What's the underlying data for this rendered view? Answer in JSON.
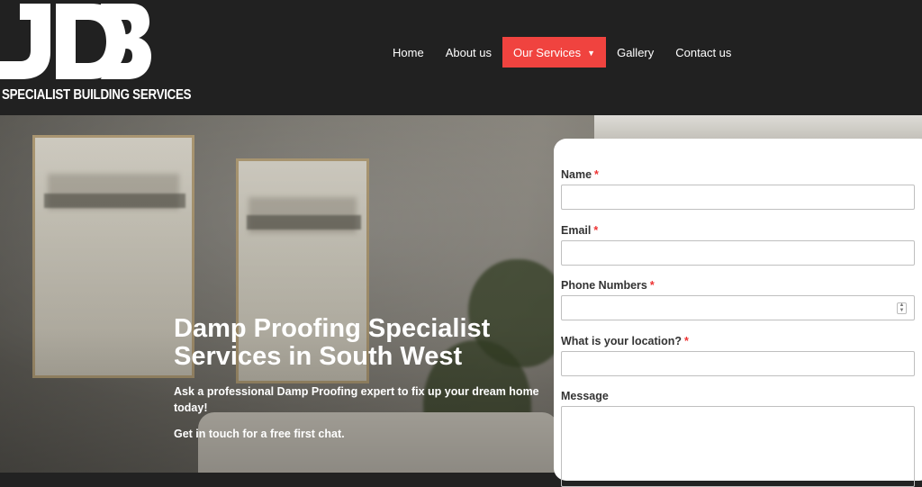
{
  "logo": {
    "mark": "JDB",
    "tagline": "SPECIALIST BUILDING SERVICES"
  },
  "nav": {
    "items": [
      {
        "label": "Home"
      },
      {
        "label": "About us"
      },
      {
        "label": "Our Services"
      },
      {
        "label": "Gallery"
      },
      {
        "label": "Contact us"
      }
    ]
  },
  "hero": {
    "title": "Damp Proofing Specialist Services in South West",
    "subtitle": "Ask a professional Damp Proofing expert to fix up your dream home today!",
    "cta": "Get in touch for a free first chat."
  },
  "form": {
    "fields": [
      {
        "label": "Name",
        "required": "*",
        "value": ""
      },
      {
        "label": "Email",
        "required": "*",
        "value": ""
      },
      {
        "label": "Phone Numbers",
        "required": "*",
        "value": ""
      },
      {
        "label": "What is your location?",
        "required": "*",
        "value": ""
      },
      {
        "label": "Message",
        "value": ""
      }
    ]
  },
  "colors": {
    "header_bg": "#212121",
    "accent": "#f0433f",
    "required": "#e33333"
  }
}
